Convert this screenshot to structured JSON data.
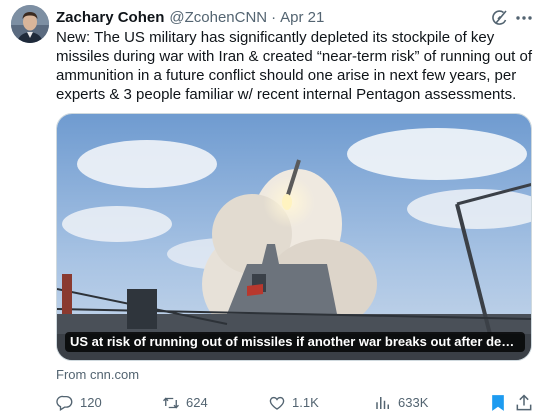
{
  "author": {
    "name": "Zachary Cohen",
    "handle": "@ZcohenCNN",
    "separator": "·",
    "time": "Apr 21"
  },
  "tweet": {
    "text": "New: The US military has significantly depleted its stockpile of key missiles during war with Iran & created “near-term risk” of running out of ammunition in a future conflict should one arise in next few years, per experts & 3 people familiar w/ recent internal Pentagon assessments."
  },
  "card": {
    "title": "US at risk of running out of missiles if another war breaks out after depleting st...",
    "source": "From cnn.com"
  },
  "actions": {
    "replies": "120",
    "reposts": "624",
    "likes": "1.1K",
    "views": "633K"
  },
  "icons": {
    "grok": "grok-icon",
    "more": "more-icon",
    "reply": "reply-icon",
    "repost": "repost-icon",
    "like": "heart-icon",
    "views": "views-icon",
    "bookmark": "bookmark-icon",
    "share": "share-icon"
  },
  "colors": {
    "text": "#0f1419",
    "secondary": "#536471",
    "bookmark_active": "#1d9bf0"
  }
}
